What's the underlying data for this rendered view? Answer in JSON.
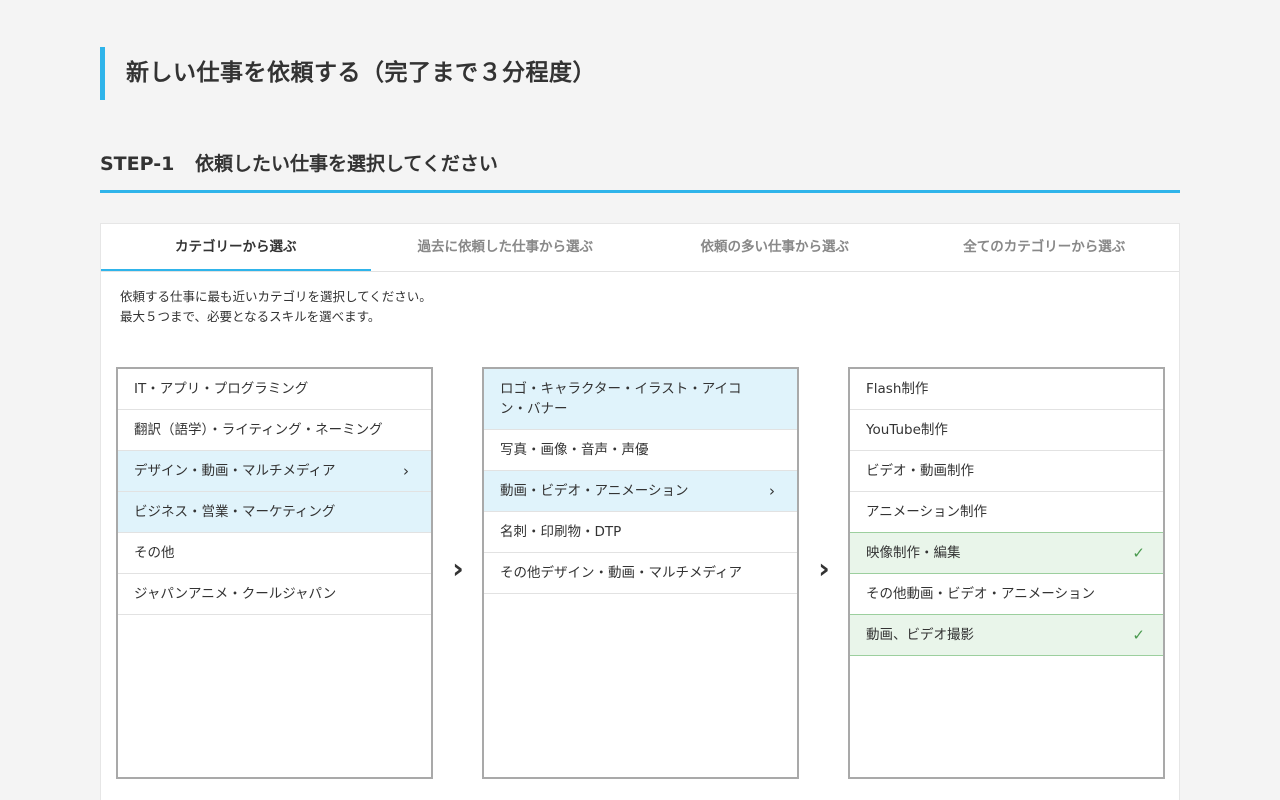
{
  "page_title": "新しい仕事を依頼する（完了まで３分程度）",
  "step": {
    "number": "STEP-1",
    "title": "依頼したい仕事を選択してください"
  },
  "tabs": [
    {
      "label": "カテゴリーから選ぶ",
      "active": true
    },
    {
      "label": "過去に依頼した仕事から選ぶ",
      "active": false
    },
    {
      "label": "依頼の多い仕事から選ぶ",
      "active": false
    },
    {
      "label": "全てのカテゴリーから選ぶ",
      "active": false
    }
  ],
  "intro": {
    "line1": "依頼する仕事に最も近いカテゴリを選択してください。",
    "line2": "最大５つまで、必要となるスキルを選べます。"
  },
  "columns": [
    {
      "items": [
        {
          "label": "IT・アプリ・プログラミング",
          "state": "normal"
        },
        {
          "label": "翻訳（語学）・ライティング・ネーミング",
          "state": "normal"
        },
        {
          "label": "デザイン・動画・マルチメディア",
          "state": "selected-active"
        },
        {
          "label": "ビジネス・営業・マーケティング",
          "state": "selected"
        },
        {
          "label": "その他",
          "state": "normal"
        },
        {
          "label": "ジャパンアニメ・クールジャパン",
          "state": "normal"
        }
      ]
    },
    {
      "items": [
        {
          "label": "ロゴ・キャラクター・イラスト・アイコン・バナー",
          "state": "selected"
        },
        {
          "label": "写真・画像・音声・声優",
          "state": "normal"
        },
        {
          "label": "動画・ビデオ・アニメーション",
          "state": "selected-active"
        },
        {
          "label": "名刺・印刷物・DTP",
          "state": "normal"
        },
        {
          "label": "その他デザイン・動画・マルチメディア",
          "state": "normal"
        }
      ]
    },
    {
      "items": [
        {
          "label": "Flash制作",
          "state": "normal"
        },
        {
          "label": "YouTube制作",
          "state": "normal"
        },
        {
          "label": "ビデオ・動画制作",
          "state": "normal"
        },
        {
          "label": "アニメーション制作",
          "state": "normal"
        },
        {
          "label": "映像制作・編集",
          "state": "checked"
        },
        {
          "label": "その他動画・ビデオ・アニメーション",
          "state": "normal"
        },
        {
          "label": "動画、ビデオ撮影",
          "state": "checked"
        }
      ]
    }
  ],
  "icons": {
    "chevron": "chevron-right-icon",
    "check": "checkmark-icon",
    "step_arrow": "arrow-right-icon"
  },
  "colors": {
    "accent": "#2fb4ea",
    "selected_bg": "#e0f3fb",
    "checked_bg": "#e9f5ea",
    "check": "#4a9a4f"
  }
}
